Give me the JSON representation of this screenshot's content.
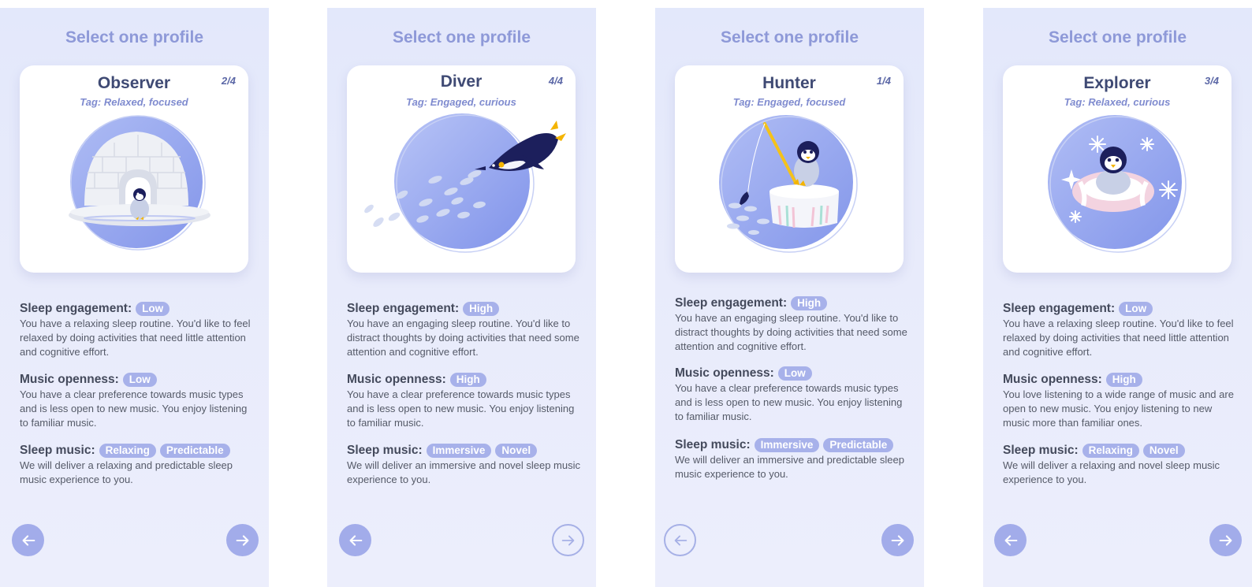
{
  "screens": [
    {
      "title": "Select one profile",
      "profile": {
        "name": "Observer",
        "counter": "2/4",
        "tag": "Tag: Relaxed, focused"
      },
      "sleep_engagement": {
        "label": "Sleep engagement:",
        "badge": "Low",
        "text": "You have a relaxing sleep routine. You'd like to feel relaxed by doing activities that need little attention and cognitive effort."
      },
      "music_openness": {
        "label": "Music openness:",
        "badge": "Low",
        "text": "You have a clear preference towards music types and is less open to new music. You enjoy listening to familiar music."
      },
      "sleep_music": {
        "label": "Sleep music:",
        "badges": [
          "Relaxing",
          "Predictable"
        ],
        "text": "We will deliver a relaxing and predictable sleep music experience to you."
      },
      "nav": {
        "back": "arrow-left-icon",
        "next": "arrow-right-icon"
      }
    },
    {
      "title": "Select one profile",
      "profile": {
        "name": "Diver",
        "counter": "4/4",
        "tag": "Tag: Engaged, curious"
      },
      "sleep_engagement": {
        "label": "Sleep engagement:",
        "badge": "High",
        "text": "You have an engaging sleep routine. You'd like to distract thoughts by doing activities that need some attention and cognitive effort."
      },
      "music_openness": {
        "label": "Music openness:",
        "badge": "High",
        "text": "You have a clear preference towards music types and is less open to new music. You enjoy listening to familiar music."
      },
      "sleep_music": {
        "label": "Sleep music:",
        "badges": [
          "Immersive",
          "Novel"
        ],
        "text": "We will deliver an immersive and novel sleep music experience to you."
      },
      "nav": {
        "back": "arrow-left-icon",
        "next": "arrow-right-icon"
      }
    },
    {
      "title": "Select one profile",
      "profile": {
        "name": "Hunter",
        "counter": "1/4",
        "tag": "Tag: Engaged, focused"
      },
      "sleep_engagement": {
        "label": "Sleep engagement:",
        "badge": "High",
        "text": "You have an engaging sleep routine. You'd like to distract thoughts by doing activities that need some attention and cognitive effort."
      },
      "music_openness": {
        "label": "Music openness:",
        "badge": "Low",
        "text": "You have a clear preference towards music types and is less open to new music. You enjoy listening to familiar music."
      },
      "sleep_music": {
        "label": "Sleep music:",
        "badges": [
          "Immersive",
          "Predictable"
        ],
        "text": "We will deliver an immersive and predictable sleep music experience to you."
      },
      "nav": {
        "back": "arrow-left-icon",
        "next": "arrow-right-icon"
      }
    },
    {
      "title": "Select one profile",
      "profile": {
        "name": "Explorer",
        "counter": "3/4",
        "tag": "Tag: Relaxed, curious"
      },
      "sleep_engagement": {
        "label": "Sleep engagement:",
        "badge": "Low",
        "text": "You have a relaxing sleep routine. You'd like to feel relaxed by doing activities that need little attention and cognitive effort."
      },
      "music_openness": {
        "label": "Music openness:",
        "badge": "High",
        "text": "You love listening to a wide range of music and are open to new music. You enjoy listening to new music more than familiar ones."
      },
      "sleep_music": {
        "label": "Sleep music:",
        "badges": [
          "Relaxing",
          "Novel"
        ],
        "text": "We will deliver a relaxing and novel sleep music experience to you."
      },
      "nav": {
        "back": "arrow-left-icon",
        "next": "arrow-right-icon"
      }
    }
  ],
  "colors": {
    "accent": "#a2acea",
    "title": "#8e99d8",
    "card_name": "#3f4a74",
    "screen_bg": "#e5e9fb",
    "penguin_navy": "#1c1f5c"
  }
}
